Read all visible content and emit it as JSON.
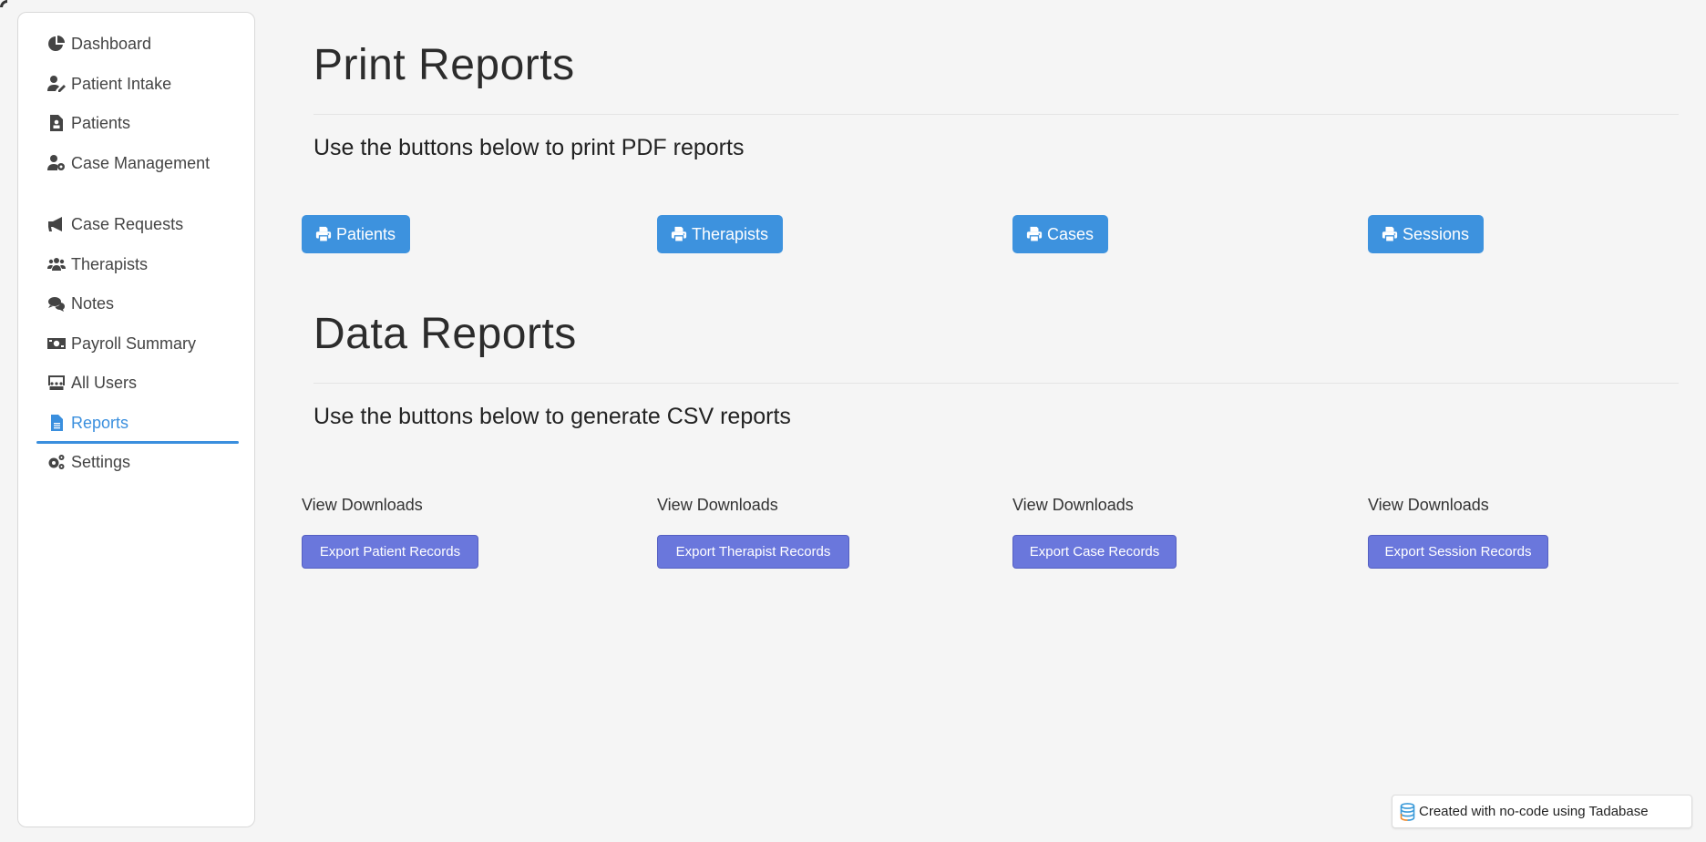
{
  "sidebar": {
    "items": [
      {
        "label": "Dashboard",
        "icon": "chart-pie-icon"
      },
      {
        "label": "Patient Intake",
        "icon": "user-edit-icon"
      },
      {
        "label": "Patients",
        "icon": "file-user-icon"
      },
      {
        "label": "Case Management",
        "icon": "user-cog-icon"
      },
      {
        "label": "Case Requests",
        "icon": "bullhorn-icon"
      },
      {
        "label": "Therapists",
        "icon": "users-icon"
      },
      {
        "label": "Notes",
        "icon": "comments-icon"
      },
      {
        "label": "Payroll Summary",
        "icon": "money-bill-icon"
      },
      {
        "label": "All Users",
        "icon": "chalkboard-teacher-icon"
      },
      {
        "label": "Reports",
        "icon": "file-alt-icon",
        "active": true
      },
      {
        "label": "Settings",
        "icon": "cogs-icon"
      }
    ],
    "accent_color": "#3a8fde"
  },
  "print_section": {
    "title": "Print Reports",
    "subtitle": "Use the buttons below to print PDF reports",
    "buttons": [
      {
        "label": "Patients",
        "icon": "print-icon"
      },
      {
        "label": "Therapists",
        "icon": "print-icon"
      },
      {
        "label": "Cases",
        "icon": "print-icon"
      },
      {
        "label": "Sessions",
        "icon": "print-icon"
      }
    ],
    "button_color": "#3d92de"
  },
  "data_section": {
    "title": "Data Reports",
    "subtitle": "Use the buttons below to generate CSV reports",
    "columns": [
      {
        "link": "View Downloads",
        "button": "Export Patient Records"
      },
      {
        "link": "View Downloads",
        "button": "Export Therapist Records"
      },
      {
        "link": "View Downloads",
        "button": "Export Case Records"
      },
      {
        "link": "View Downloads",
        "button": "Export Session Records"
      }
    ],
    "button_color": "#6a77dc"
  },
  "footer_badge": {
    "text": "Created with no-code using Tadabase",
    "icon": "database-icon"
  }
}
